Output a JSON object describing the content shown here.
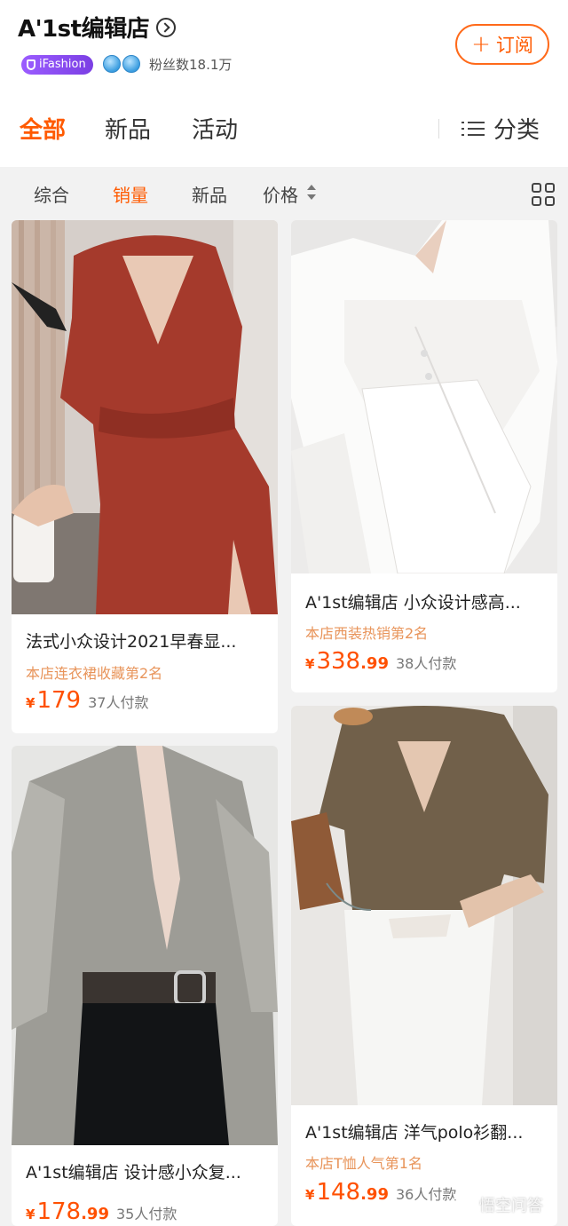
{
  "shop": {
    "name": "A'1st编辑店",
    "badge": "iFashion",
    "fans": "粉丝数18.1万",
    "subscribe_label": "订阅"
  },
  "main_tabs": [
    {
      "label": "全部",
      "active": true
    },
    {
      "label": "新品",
      "active": false
    },
    {
      "label": "活动",
      "active": false
    }
  ],
  "category_label": "分类",
  "sort": [
    {
      "label": "综合",
      "active": false
    },
    {
      "label": "销量",
      "active": true
    },
    {
      "label": "新品",
      "active": false
    },
    {
      "label": "价格",
      "active": false
    }
  ],
  "products": [
    {
      "title": "法式小众设计2021早春显...",
      "rank": "本店连衣裙收藏第2名",
      "currency": "¥",
      "price_int": "179",
      "price_dec": "",
      "sold": "37人付款",
      "image": "rust red wrap dress"
    },
    {
      "title": "A'1st编辑店 小众设计感高...",
      "rank": "本店西装热销第2名",
      "currency": "¥",
      "price_int": "338",
      "price_dec": ".99",
      "sold": "38人付款",
      "image": "white wrap blazer"
    },
    {
      "title": "A'1st编辑店 设计感小众复...",
      "rank": "",
      "currency": "¥",
      "price_int": "178",
      "price_dec": ".99",
      "sold": "35人付款",
      "image": "grey satin shirt"
    },
    {
      "title": "A'1st编辑店 洋气polo衫翻...",
      "rank": "本店T恤人气第1名",
      "currency": "¥",
      "price_int": "148",
      "price_dec": ".99",
      "sold": "36人付款",
      "image": "olive knit polo"
    }
  ],
  "watermark": "悟空问答",
  "colors": {
    "accent": "#ff5a00",
    "rank": "#e8945a",
    "badge": "#8b4cf0"
  }
}
